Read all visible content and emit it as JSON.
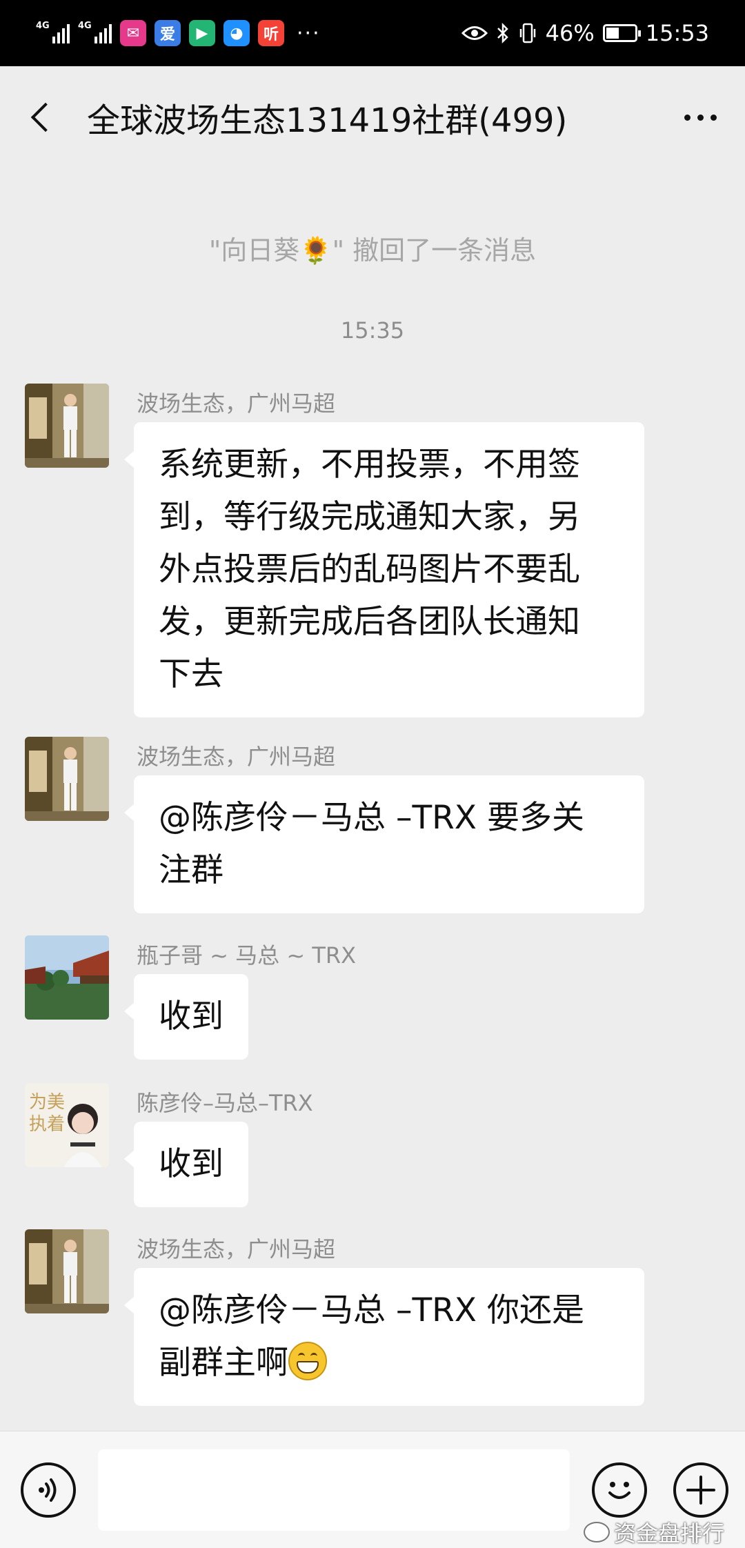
{
  "status_bar": {
    "net1": "4G",
    "net2": "4G",
    "apps": [
      {
        "name": "weibo-like-icon",
        "glyph": "✉",
        "color": "#e6398b"
      },
      {
        "name": "ai-app-icon",
        "glyph": "爱",
        "color": "#3b7de6"
      },
      {
        "name": "video-app-icon",
        "glyph": "▶",
        "color": "#22b573"
      },
      {
        "name": "q-app-icon",
        "glyph": "◕",
        "color": "#1e90ff"
      },
      {
        "name": "listen-app-icon",
        "glyph": "听",
        "color": "#f44336"
      }
    ],
    "more": "···",
    "battery_text": "46%",
    "battery_level": 0.46,
    "time": "15:53"
  },
  "header": {
    "title": "全球波场生态131419社群(499)"
  },
  "messages": {
    "system_notice": "\"向日葵🌻\" 撤回了一条消息",
    "timestamp": "15:35",
    "items": [
      {
        "sender": "波场生态，广州马超",
        "lines": [
          "系统更新，不用投票，不用签",
          "到，等行级完成通知大家，另",
          "外点投票后的乱码图片不要乱",
          "发，更新完成后各团队长通知",
          "下去"
        ]
      },
      {
        "sender": "波场生态，广州马超",
        "lines": [
          "@陈彦伶－马总 –TRX  要多关",
          "注群"
        ]
      },
      {
        "sender": "瓶子哥 ~ 马总 ~ TRX",
        "lines": [
          "收到"
        ]
      },
      {
        "sender": "陈彦伶–马总–TRX",
        "lines": [
          "收到"
        ],
        "avatar_text": "为美\n执着"
      },
      {
        "sender": "波场生态，广州马超",
        "lines": [
          "@陈彦伶－马总 –TRX  你还是",
          "副群主啊"
        ]
      }
    ]
  },
  "input_bar": {
    "placeholder": ""
  },
  "watermark": {
    "text": "资金盘排行"
  }
}
